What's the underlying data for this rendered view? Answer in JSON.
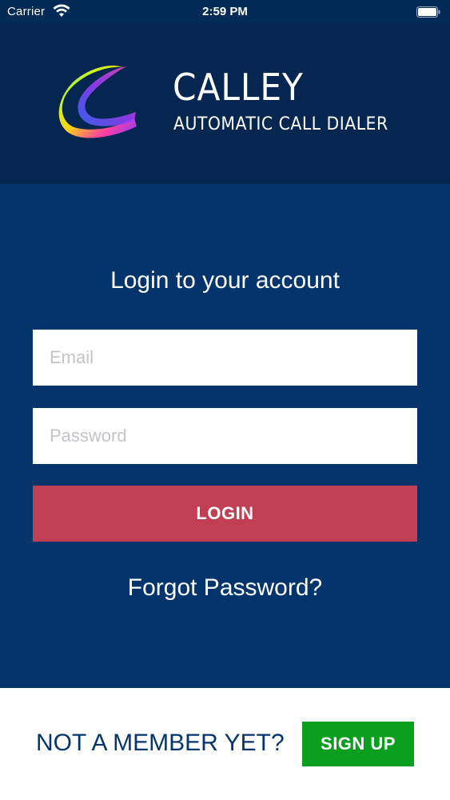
{
  "status_bar": {
    "carrier": "Carrier",
    "time": "2:59 PM",
    "wifi_icon": "wifi-icon",
    "battery_icon": "battery-icon"
  },
  "header": {
    "brand_name": "CALLEY",
    "tagline": "AUTOMATIC CALL DIALER",
    "logo_icon": "calley-logo"
  },
  "login": {
    "heading": "Login to your account",
    "email_placeholder": "Email",
    "email_value": "",
    "password_placeholder": "Password",
    "password_value": "",
    "login_label": "LOGIN",
    "forgot_label": "Forgot Password?"
  },
  "footer": {
    "member_text": "NOT A MEMBER YET?",
    "signup_label": "SIGN UP"
  },
  "colors": {
    "status_bar_bg": "#022a57",
    "header_bg": "#052650",
    "panel_bg": "#03346b",
    "login_button": "#c13f53",
    "signup_button": "#0a9e1e",
    "footer_text": "#05356b"
  }
}
